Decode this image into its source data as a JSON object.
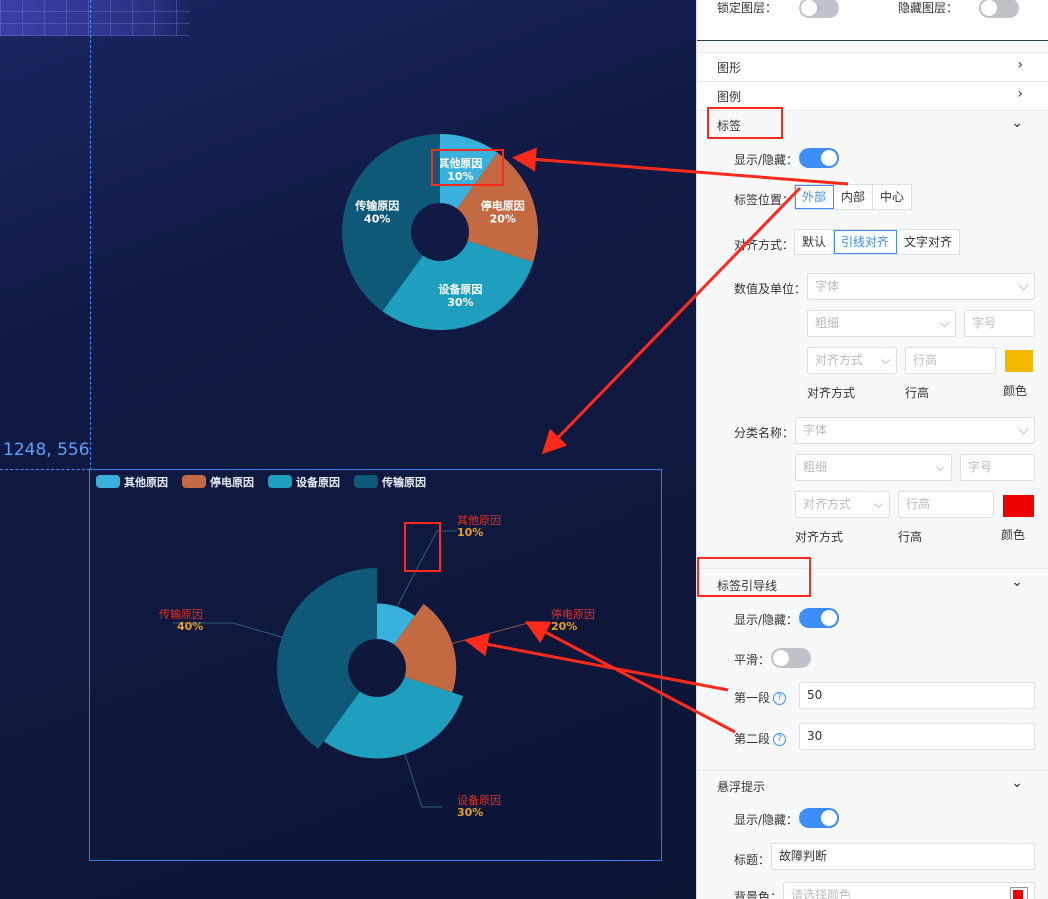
{
  "canvas": {
    "coord_readout": "1248, 556",
    "chart_top": {
      "slices": [
        {
          "name": "其他原因",
          "pct": "10%",
          "value": 10,
          "color": "#3ab0dc"
        },
        {
          "name": "停电原因",
          "pct": "20%",
          "value": 20,
          "color": "#c46a42"
        },
        {
          "name": "设备原因",
          "pct": "30%",
          "value": 30,
          "color": "#1f9fbe"
        },
        {
          "name": "传输原因",
          "pct": "40%",
          "value": 40,
          "color": "#0e5878"
        }
      ]
    },
    "chart_bottom": {
      "legend": [
        "其他原因",
        "停电原因",
        "设备原因",
        "传输原因"
      ],
      "label_name_color": "#e8301f",
      "label_value_color": "#e8a21a",
      "slices": [
        {
          "name": "其他原因",
          "pct": "10%",
          "value": 10
        },
        {
          "name": "停电原因",
          "pct": "20%",
          "value": 20
        },
        {
          "name": "设备原因",
          "pct": "30%",
          "value": 30
        },
        {
          "name": "传输原因",
          "pct": "40%",
          "value": 40
        }
      ]
    }
  },
  "chart_data": {
    "type": "pie",
    "categories": [
      "其他原因",
      "停电原因",
      "设备原因",
      "传输原因"
    ],
    "values": [
      10,
      20,
      30,
      40
    ]
  },
  "panel": {
    "lock_layer_label": "锁定图层：",
    "hide_layer_label": "隐藏图层：",
    "sections": {
      "shape": "图形",
      "legend": "图例",
      "label": "标签",
      "label_guide": "标签引导线",
      "tooltip": "悬浮提示"
    },
    "label": {
      "show_label": "显示/隐藏：",
      "position_label": "标签位置：",
      "position_options": [
        "外部",
        "内部",
        "中心"
      ],
      "align_label": "对齐方式：",
      "align_options": [
        "默认",
        "引线对齐",
        "文字对齐"
      ],
      "value_unit_label": "数值及单位：",
      "category_name_label": "分类名称：",
      "font_placeholder": "字体",
      "weight_placeholder": "粗细",
      "size_placeholder": "字号",
      "align_placeholder": "对齐方式",
      "line_height_placeholder": "行高",
      "cap_align": "对齐方式",
      "cap_line_height": "行高",
      "cap_color": "颜色",
      "value_color": "#f5b800",
      "name_color": "#ee0000"
    },
    "guide": {
      "show_label": "显示/隐藏：",
      "smooth_label": "平滑：",
      "first_label": "第一段",
      "first_value": "50",
      "second_label": "第二段",
      "second_value": "30"
    },
    "tooltip": {
      "show_label": "显示/隐藏：",
      "title_label": "标题：",
      "title_value": "故障判断",
      "bg_label": "背景色：",
      "bg_placeholder": "请选择颜色"
    },
    "icons": {
      "expand": "chevron-right-icon",
      "collapse": "chevron-down-icon",
      "help": "question-circle-icon"
    }
  }
}
